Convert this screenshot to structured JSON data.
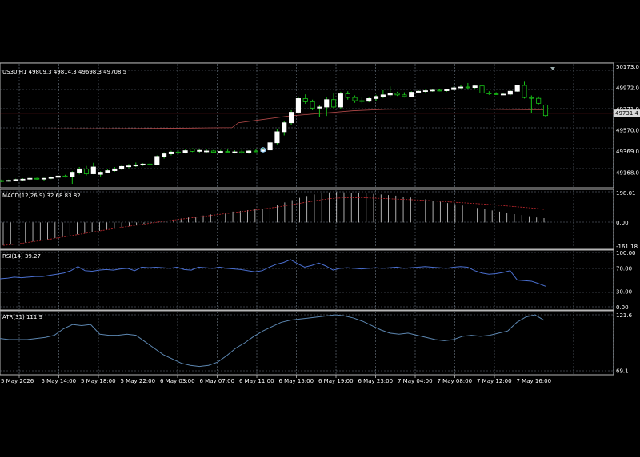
{
  "symbol_header": "US30,H1  49809.3 49814.3 49698.3 49708.5",
  "colors": {
    "background": "#000000",
    "chart_area": "#000000",
    "grid": "#6e7a86",
    "panel_border": "#b4b4b4",
    "bull_body": "#ffffff",
    "bear_body": "#000000",
    "wick": "#18c418",
    "current_price_line": "#c0282e",
    "ma_line": "#b44a4a",
    "macd_signal": "#c0282e",
    "macd_hist": "#d8d8d8",
    "rsi_line": "#4a6fd0",
    "atr_line": "#5c86b0",
    "price_tag_bg": "#d8d8d8",
    "price_tag_text": "#000000",
    "axis_text": "#ffffff"
  },
  "chart_data": [
    {
      "type": "candlestick",
      "title": "US30,H1  49809.3 49814.3 49698.3 49708.5",
      "y_ticks": [
        "50173.0",
        "49972.0",
        "49771.0",
        "49570.0",
        "49369.0",
        "49168.0"
      ],
      "ylim": [
        49030,
        50200
      ],
      "current_price": "49731.4",
      "current_price_value": 49731.4,
      "ma_overlay": [
        [
          0,
          49580
        ],
        [
          10,
          49583
        ],
        [
          20,
          49585
        ],
        [
          30,
          49590
        ],
        [
          36,
          49594
        ],
        [
          37,
          49640
        ],
        [
          40,
          49665
        ],
        [
          45,
          49705
        ],
        [
          50,
          49730
        ],
        [
          55,
          49755
        ],
        [
          60,
          49768
        ],
        [
          65,
          49771
        ],
        [
          70,
          49772
        ],
        [
          75,
          49770
        ],
        [
          80,
          49766
        ],
        [
          85,
          49762
        ]
      ],
      "candles": [
        {
          "o": 49090,
          "h": 49100,
          "l": 49075,
          "c": 49085
        },
        {
          "o": 49088,
          "h": 49100,
          "l": 49080,
          "c": 49092
        },
        {
          "o": 49092,
          "h": 49108,
          "l": 49086,
          "c": 49100
        },
        {
          "o": 49098,
          "h": 49112,
          "l": 49090,
          "c": 49104
        },
        {
          "o": 49104,
          "h": 49120,
          "l": 49096,
          "c": 49112
        },
        {
          "o": 49112,
          "h": 49118,
          "l": 49100,
          "c": 49106
        },
        {
          "o": 49106,
          "h": 49118,
          "l": 49090,
          "c": 49112
        },
        {
          "o": 49112,
          "h": 49130,
          "l": 49104,
          "c": 49122
        },
        {
          "o": 49122,
          "h": 49142,
          "l": 49112,
          "c": 49134
        },
        {
          "o": 49134,
          "h": 49146,
          "l": 49120,
          "c": 49128
        },
        {
          "o": 49128,
          "h": 49180,
          "l": 49060,
          "c": 49170
        },
        {
          "o": 49170,
          "h": 49220,
          "l": 49150,
          "c": 49200
        },
        {
          "o": 49200,
          "h": 49230,
          "l": 49140,
          "c": 49155
        },
        {
          "o": 49155,
          "h": 49260,
          "l": 49150,
          "c": 49220
        },
        {
          "o": 49150,
          "h": 49180,
          "l": 49130,
          "c": 49170
        },
        {
          "o": 49170,
          "h": 49200,
          "l": 49160,
          "c": 49185
        },
        {
          "o": 49185,
          "h": 49220,
          "l": 49175,
          "c": 49200
        },
        {
          "o": 49200,
          "h": 49236,
          "l": 49190,
          "c": 49225
        },
        {
          "o": 49225,
          "h": 49248,
          "l": 49210,
          "c": 49230
        },
        {
          "o": 49230,
          "h": 49262,
          "l": 49220,
          "c": 49240
        },
        {
          "o": 49240,
          "h": 49256,
          "l": 49230,
          "c": 49248
        },
        {
          "o": 49248,
          "h": 49262,
          "l": 49230,
          "c": 49244
        },
        {
          "o": 49244,
          "h": 49330,
          "l": 49236,
          "c": 49320
        },
        {
          "o": 49320,
          "h": 49360,
          "l": 49300,
          "c": 49345
        },
        {
          "o": 49345,
          "h": 49375,
          "l": 49330,
          "c": 49362
        },
        {
          "o": 49362,
          "h": 49380,
          "l": 49340,
          "c": 49358
        },
        {
          "o": 49358,
          "h": 49385,
          "l": 49348,
          "c": 49375
        },
        {
          "o": 49392,
          "h": 49398,
          "l": 49362,
          "c": 49369
        },
        {
          "o": 49369,
          "h": 49390,
          "l": 49352,
          "c": 49378
        },
        {
          "o": 49365,
          "h": 49390,
          "l": 49355,
          "c": 49372
        },
        {
          "o": 49372,
          "h": 49382,
          "l": 49354,
          "c": 49360
        },
        {
          "o": 49360,
          "h": 49382,
          "l": 49352,
          "c": 49368
        },
        {
          "o": 49368,
          "h": 49386,
          "l": 49350,
          "c": 49360
        },
        {
          "o": 49360,
          "h": 49378,
          "l": 49348,
          "c": 49364
        },
        {
          "o": 49364,
          "h": 49384,
          "l": 49346,
          "c": 49355
        },
        {
          "o": 49355,
          "h": 49380,
          "l": 49346,
          "c": 49372
        },
        {
          "o": 49372,
          "h": 49392,
          "l": 49360,
          "c": 49368
        },
        {
          "o": 49368,
          "h": 49400,
          "l": 49362,
          "c": 49382
        },
        {
          "o": 49382,
          "h": 49465,
          "l": 49375,
          "c": 49450
        },
        {
          "o": 49450,
          "h": 49580,
          "l": 49435,
          "c": 49555
        },
        {
          "o": 49555,
          "h": 49660,
          "l": 49520,
          "c": 49640
        },
        {
          "o": 49640,
          "h": 49760,
          "l": 49620,
          "c": 49740
        },
        {
          "o": 49740,
          "h": 49890,
          "l": 49725,
          "c": 49870
        },
        {
          "o": 49870,
          "h": 49910,
          "l": 49820,
          "c": 49840
        },
        {
          "o": 49840,
          "h": 49860,
          "l": 49760,
          "c": 49780
        },
        {
          "o": 49780,
          "h": 49810,
          "l": 49695,
          "c": 49790
        },
        {
          "o": 49790,
          "h": 49885,
          "l": 49705,
          "c": 49860
        },
        {
          "o": 49860,
          "h": 49920,
          "l": 49780,
          "c": 49790
        },
        {
          "o": 49790,
          "h": 49935,
          "l": 49770,
          "c": 49915
        },
        {
          "o": 49915,
          "h": 49940,
          "l": 49860,
          "c": 49880
        },
        {
          "o": 49880,
          "h": 49900,
          "l": 49830,
          "c": 49850
        },
        {
          "o": 49850,
          "h": 49880,
          "l": 49825,
          "c": 49845
        },
        {
          "o": 49845,
          "h": 49880,
          "l": 49835,
          "c": 49870
        },
        {
          "o": 49870,
          "h": 49905,
          "l": 49850,
          "c": 49890
        },
        {
          "o": 49890,
          "h": 49950,
          "l": 49875,
          "c": 49905
        },
        {
          "o": 49905,
          "h": 49985,
          "l": 49890,
          "c": 49920
        },
        {
          "o": 49920,
          "h": 49935,
          "l": 49895,
          "c": 49905
        },
        {
          "o": 49905,
          "h": 49930,
          "l": 49880,
          "c": 49890
        },
        {
          "o": 49890,
          "h": 49940,
          "l": 49882,
          "c": 49930
        },
        {
          "o": 49930,
          "h": 49950,
          "l": 49920,
          "c": 49940
        },
        {
          "o": 49940,
          "h": 49955,
          "l": 49920,
          "c": 49945
        },
        {
          "o": 49945,
          "h": 49960,
          "l": 49935,
          "c": 49950
        },
        {
          "o": 49950,
          "h": 49962,
          "l": 49940,
          "c": 49945
        },
        {
          "o": 49945,
          "h": 49962,
          "l": 49935,
          "c": 49955
        },
        {
          "o": 49955,
          "h": 49985,
          "l": 49948,
          "c": 49972
        },
        {
          "o": 49972,
          "h": 49996,
          "l": 49960,
          "c": 49980
        },
        {
          "o": 49980,
          "h": 50018,
          "l": 49960,
          "c": 49975
        },
        {
          "o": 49975,
          "h": 50002,
          "l": 49958,
          "c": 49990
        },
        {
          "o": 49990,
          "h": 49998,
          "l": 49918,
          "c": 49922
        },
        {
          "o": 49922,
          "h": 49940,
          "l": 49905,
          "c": 49915
        },
        {
          "o": 49915,
          "h": 49930,
          "l": 49905,
          "c": 49908
        },
        {
          "o": 49908,
          "h": 49924,
          "l": 49905,
          "c": 49912
        },
        {
          "o": 49912,
          "h": 49950,
          "l": 49900,
          "c": 49940
        },
        {
          "o": 49940,
          "h": 50000,
          "l": 49935,
          "c": 49995
        },
        {
          "o": 49995,
          "h": 50030,
          "l": 49870,
          "c": 49880
        },
        {
          "o": 49880,
          "h": 49900,
          "l": 49730,
          "c": 49872
        },
        {
          "o": 49872,
          "h": 49890,
          "l": 49815,
          "c": 49825
        },
        {
          "o": 49809.3,
          "h": 49814.3,
          "l": 49698.3,
          "c": 49708.5
        }
      ]
    },
    {
      "type": "bar",
      "title": "MACD(12,26,9) 32.68 83.82",
      "y_ticks": [
        "198.01",
        "0.00",
        "-161.18"
      ],
      "ylim": [
        -170,
        210
      ],
      "histogram": [
        -150,
        -145,
        -140,
        -132,
        -125,
        -118,
        -110,
        -102,
        -95,
        -85,
        -78,
        -70,
        -62,
        -55,
        -48,
        -40,
        -32,
        -25,
        -18,
        -10,
        -3,
        5,
        12,
        18,
        25,
        32,
        38,
        45,
        52,
        58,
        64,
        70,
        75,
        80,
        85,
        90,
        100,
        115,
        130,
        145,
        160,
        172,
        182,
        190,
        196,
        198,
        196,
        194,
        192,
        190,
        186,
        182,
        178,
        174,
        168,
        162,
        156,
        150,
        142,
        134,
        126,
        118,
        110,
        102,
        94,
        86,
        78,
        70,
        62,
        54,
        48,
        40,
        32,
        28
      ],
      "signal": [
        -150,
        -145,
        -140,
        -133,
        -126,
        -119,
        -112,
        -104,
        -96,
        -88,
        -80,
        -72,
        -64,
        -56,
        -48,
        -40,
        -32,
        -25,
        -18,
        -11,
        -4,
        3,
        9,
        15,
        21,
        27,
        33,
        39,
        45,
        51,
        57,
        63,
        69,
        75,
        81,
        87,
        93,
        100,
        108,
        116,
        124,
        132,
        140,
        148,
        154,
        158,
        160,
        161,
        161,
        160,
        158,
        156,
        154,
        152,
        150,
        148,
        146,
        143,
        140,
        137,
        134,
        131,
        128,
        125,
        122,
        119,
        115,
        111,
        107,
        103,
        99,
        95,
        91,
        85
      ]
    },
    {
      "type": "line",
      "title": "RSI(14) 39.27",
      "y_ticks": [
        "100.00",
        "70.00",
        "30.00",
        "0.00"
      ],
      "ylim": [
        0,
        100
      ],
      "values": [
        52,
        53,
        55,
        54,
        55,
        56,
        56,
        58,
        60,
        62,
        66,
        73,
        66,
        65,
        67,
        68,
        67,
        69,
        70,
        66,
        72,
        71,
        72,
        71,
        70,
        72,
        68,
        67,
        72,
        71,
        70,
        72,
        70,
        69,
        68,
        66,
        64,
        66,
        72,
        77,
        80,
        85,
        78,
        72,
        75,
        79,
        74,
        67,
        70,
        71,
        70,
        69,
        70,
        71,
        70,
        71,
        72,
        70,
        71,
        72,
        73,
        72,
        71,
        70,
        72,
        73,
        72,
        66,
        62,
        60,
        61,
        63,
        66,
        50,
        49,
        48,
        44,
        39.27
      ]
    },
    {
      "type": "line",
      "title": "ATR(31) 111.9",
      "y_ticks": [
        "121.6",
        "69.1"
      ],
      "ylim": [
        66,
        124
      ],
      "values": [
        99,
        98,
        98,
        98,
        99,
        100,
        102,
        108,
        112,
        111,
        112,
        103,
        102,
        102,
        103,
        102,
        96,
        90,
        84,
        80,
        76,
        74,
        73,
        74,
        77,
        83,
        90,
        95,
        101,
        106,
        110,
        114,
        116,
        117,
        118,
        119,
        120,
        121,
        120,
        118,
        115,
        111,
        107,
        104,
        103,
        104,
        102,
        100,
        98,
        97,
        98,
        101,
        102,
        101,
        102,
        104,
        106,
        114,
        119,
        121,
        116
      ]
    }
  ],
  "x_ticks": [
    "5 May 2026",
    "5 May 14:00",
    "5 May 18:00",
    "5 May 22:00",
    "6 May 03:00",
    "6 May 07:00",
    "6 May 11:00",
    "6 May 15:00",
    "6 May 19:00",
    "6 May 23:00",
    "7 May 04:00",
    "7 May 08:00",
    "7 May 12:00",
    "7 May 16:00"
  ],
  "objects": {
    "flag_icon": "info-marker-icon",
    "scroll_marker": "scroll-arrow-icon"
  }
}
